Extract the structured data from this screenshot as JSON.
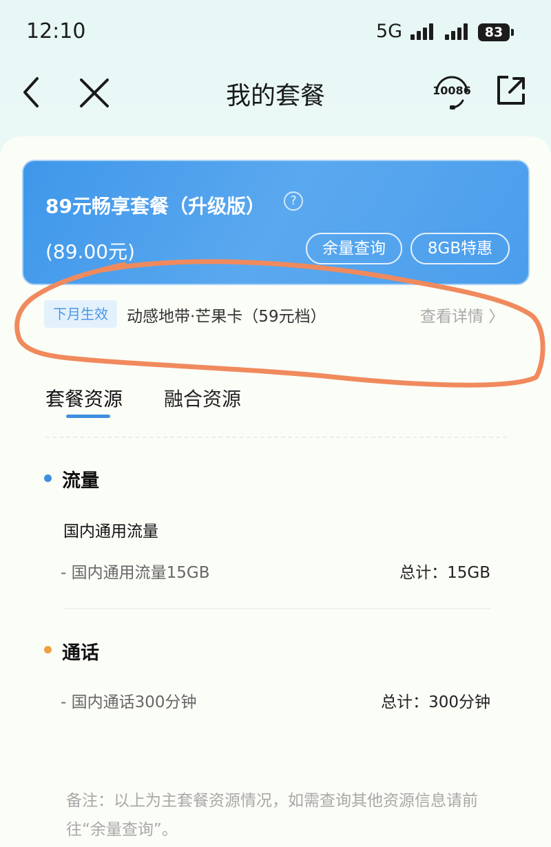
{
  "status_bar": {
    "time": "12:10",
    "network": "5G",
    "battery": "83"
  },
  "nav": {
    "title": "我的套餐",
    "hotline": "10086"
  },
  "plan": {
    "name": "89元畅享套餐（升级版）",
    "help": "?",
    "price": "(89.00元)",
    "balance_button": "余量查询",
    "offer_button": "8GB特惠"
  },
  "next_month": {
    "badge": "下月生效",
    "plan": "动感地带·芒果卡（59元档）",
    "details_link": "查看详情 〉"
  },
  "tabs": [
    {
      "label": "套餐资源",
      "active": true
    },
    {
      "label": "融合资源",
      "active": false
    }
  ],
  "data_section": {
    "title": "流量",
    "dot_color": "#3d8fe0",
    "subtitle": "国内通用流量",
    "items": [
      {
        "label": "- 国内通用流量15GB",
        "total": "总计：15GB"
      }
    ]
  },
  "call_section": {
    "title": "通话",
    "dot_color": "#f0a040",
    "items": [
      {
        "label": "- 国内通话300分钟",
        "total": "总计：300分钟"
      }
    ]
  },
  "note": "备注：以上为主套餐资源情况，如需查询其他资源信息请前往“余量查询”。",
  "colors": {
    "accent": "#3d8fe0",
    "annotation": "#f08a5d"
  }
}
